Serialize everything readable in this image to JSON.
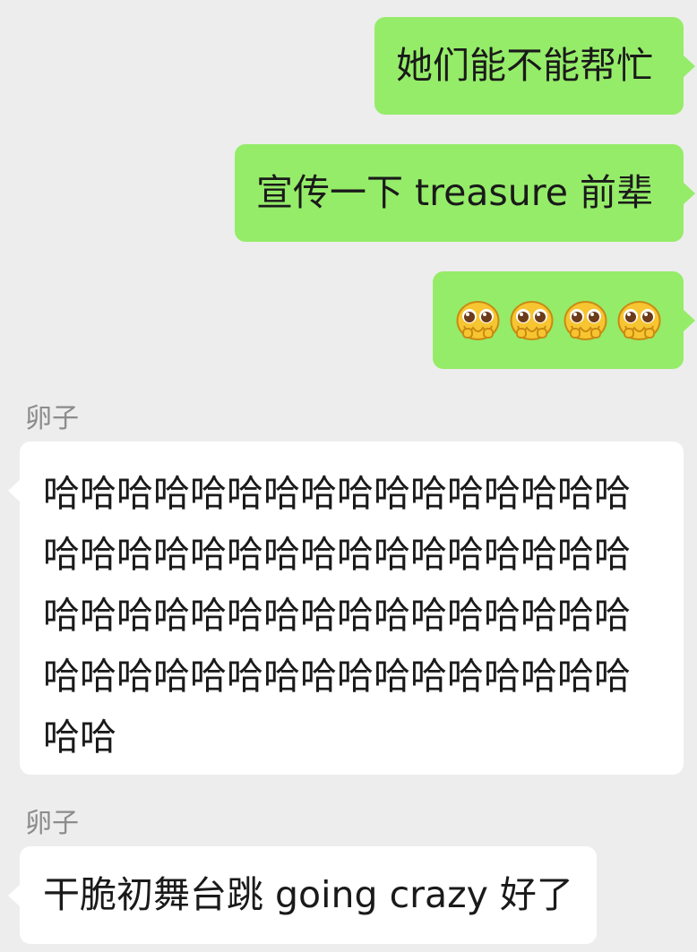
{
  "messages": [
    {
      "sender": "",
      "direction": "sent",
      "text": "她们能不能帮忙"
    },
    {
      "sender": "",
      "direction": "sent",
      "text": "宣传一下 treasure 前辈"
    },
    {
      "sender": "",
      "direction": "sent",
      "emoji": [
        "pleading-face-icon",
        "pleading-face-icon",
        "pleading-face-icon",
        "pleading-face-icon"
      ]
    },
    {
      "sender": "卵子",
      "direction": "received",
      "text": "哈哈哈哈哈哈哈哈哈哈哈哈哈哈哈哈哈哈哈哈哈哈哈哈哈哈哈哈哈哈哈哈哈哈哈哈哈哈哈哈哈哈哈哈哈哈哈哈哈哈哈哈哈哈哈哈哈哈哈哈哈哈哈哈哈哈"
    },
    {
      "sender": "卵子",
      "direction": "received",
      "text": "干脆初舞台跳 going crazy 好了"
    }
  ],
  "colors": {
    "background": "#ededed",
    "sent_bubble": "#95ec69",
    "received_bubble": "#ffffff",
    "sender_name": "#8c8c8c"
  }
}
